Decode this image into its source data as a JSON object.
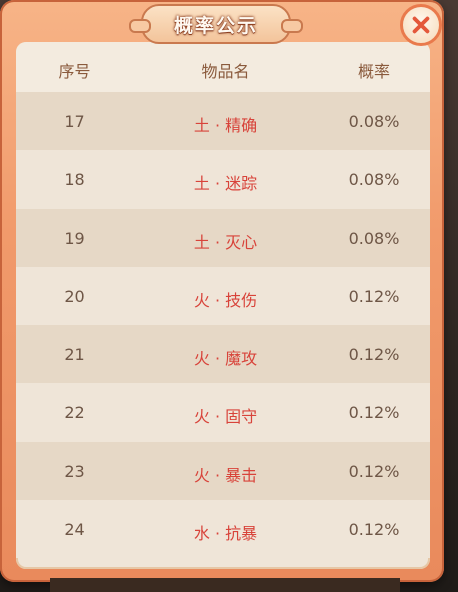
{
  "dialog": {
    "title": "概率公示",
    "close_icon": "close-icon",
    "accent_color": "#e97a4c"
  },
  "table": {
    "headers": {
      "index": "序号",
      "name": "物品名",
      "probability": "概率"
    },
    "rows": [
      {
        "index": "17",
        "name": "土 · 精确",
        "probability": "0.08%"
      },
      {
        "index": "18",
        "name": "土 · 迷踪",
        "probability": "0.08%"
      },
      {
        "index": "19",
        "name": "土 · 灭心",
        "probability": "0.08%"
      },
      {
        "index": "20",
        "name": "火 · 技伤",
        "probability": "0.12%"
      },
      {
        "index": "21",
        "name": "火 · 魔攻",
        "probability": "0.12%"
      },
      {
        "index": "22",
        "name": "火 · 固守",
        "probability": "0.12%"
      },
      {
        "index": "23",
        "name": "火 · 暴击",
        "probability": "0.12%"
      },
      {
        "index": "24",
        "name": "水 · 抗暴",
        "probability": "0.12%"
      }
    ]
  }
}
